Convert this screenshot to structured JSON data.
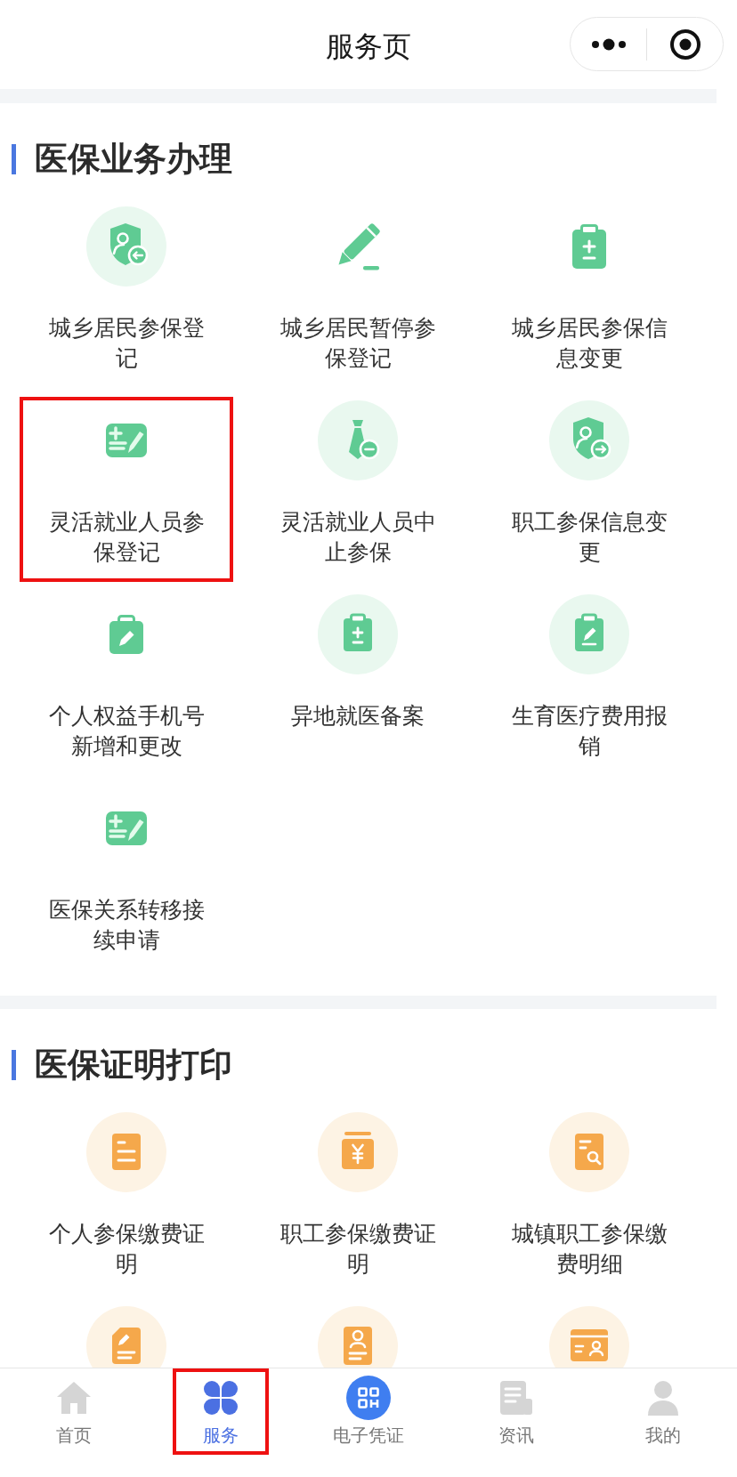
{
  "header": {
    "title": "服务页"
  },
  "sections": [
    {
      "title": "医保业务办理",
      "items": [
        {
          "label": "城乡居民参保登记",
          "highlighted": false
        },
        {
          "label": "城乡居民暂停参保登记",
          "highlighted": false
        },
        {
          "label": "城乡居民参保信息变更",
          "highlighted": false
        },
        {
          "label": "灵活就业人员参保登记",
          "highlighted": true
        },
        {
          "label": "灵活就业人员中止参保",
          "highlighted": false
        },
        {
          "label": "职工参保信息变更",
          "highlighted": false
        },
        {
          "label": "个人权益手机号新增和更改",
          "highlighted": false
        },
        {
          "label": "异地就医备案",
          "highlighted": false
        },
        {
          "label": "生育医疗费用报销",
          "highlighted": false
        },
        {
          "label": "医保关系转移接续申请",
          "highlighted": false
        }
      ]
    },
    {
      "title": "医保证明打印",
      "items": [
        {
          "label": "个人参保缴费证明",
          "highlighted": false
        },
        {
          "label": "职工参保缴费证明",
          "highlighted": false
        },
        {
          "label": "城镇职工参保缴费明细",
          "highlighted": false
        },
        {
          "highlighted": false
        },
        {
          "highlighted": false
        },
        {
          "highlighted": false
        }
      ]
    }
  ],
  "tab_bar": [
    {
      "label": "首页",
      "selected": false,
      "highlighted": false
    },
    {
      "label": "服务",
      "selected": true,
      "highlighted": true
    },
    {
      "label": "电子凭证",
      "selected": false,
      "highlighted": false
    },
    {
      "label": "资讯",
      "selected": false,
      "highlighted": false
    },
    {
      "label": "我的",
      "selected": false,
      "highlighted": false
    }
  ]
}
